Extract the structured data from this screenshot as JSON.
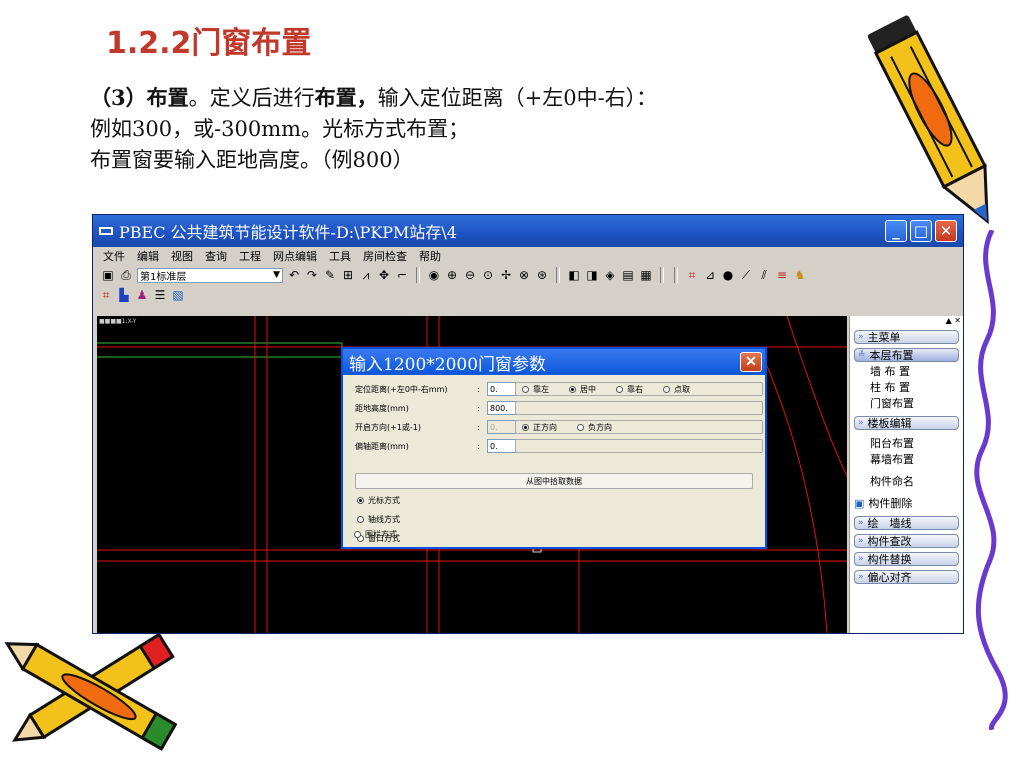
{
  "slide": {
    "title": "1.2.2门窗布置",
    "line1_a": "（3）",
    "line1_b": "布置",
    "line1_c": "。定义后进行",
    "line1_d": "布置，",
    "line1_e": "输入定位距离（+左0中-右）：",
    "line2": "例如300，或-300mm。光标方式布置；",
    "line3": "布置窗要输入距地高度。（例800）"
  },
  "app": {
    "title": "PBEC 公共建筑节能设计软件-D:\\PKPM站存\\4",
    "menu": [
      "文件",
      "编辑",
      "视图",
      "查询",
      "工程",
      "网点编辑",
      "工具",
      "房间检查",
      "帮助"
    ],
    "floor_select": "第1标准层",
    "canvas_label": "■■■■1:X-Y"
  },
  "side_panel": {
    "main_menu": "主菜单",
    "floor_layout": "本层布置",
    "floor_items": [
      "墙 布 置",
      "柱 布 置",
      "门窗布置"
    ],
    "slab_edit": "楼板编辑",
    "slab_items": [
      "阳台布置",
      "幕墙布置"
    ],
    "name_component": "构件命名",
    "delete_component": "构件删除",
    "draw_wall": "绘　墙线",
    "query_component": "构件查改",
    "replace_component": "构件替换",
    "eccentric_align": "偏心对齐"
  },
  "dialog": {
    "title": "输入1200*2000门窗参数",
    "offset_label": "定位距离(+左0中-右mm)",
    "offset_value": "0.",
    "height_label": "距地高度(mm)",
    "height_value": "800.",
    "direction_label": "开启方向(+1或-1)",
    "direction_value": "0.",
    "axis_offset_label": "偏轴距离(mm)",
    "axis_offset_value": "0.",
    "align_options": [
      "靠左",
      "居中",
      "靠右",
      "点取"
    ],
    "align_selected": 1,
    "direction_options": [
      "正方向",
      "负方向"
    ],
    "direction_selected": 0,
    "pick_button": "从图中拾取数据",
    "modes": [
      "光标方式",
      "轴线方式",
      "窗口方式",
      "围栏方式"
    ],
    "mode_selected": 0
  },
  "colors": {
    "title_red": "#c0392b",
    "xp_blue": "#0a56d8",
    "canvas_bg": "#000000",
    "grid_red": "#e01010",
    "grid_green": "#30c030"
  }
}
